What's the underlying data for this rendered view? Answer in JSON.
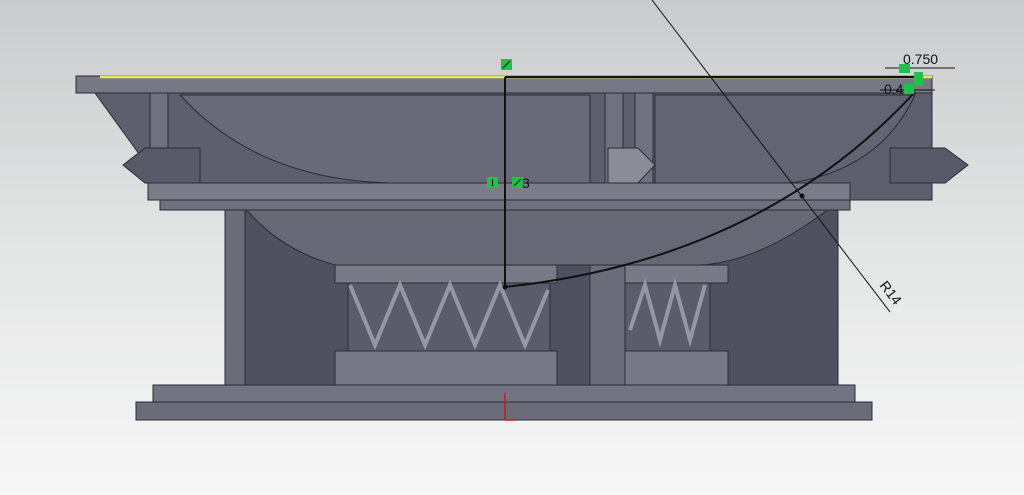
{
  "viewport": {
    "dimensions": [
      {
        "id": "width-dim",
        "label": "0.750"
      },
      {
        "id": "offset-dim",
        "label": "0.4"
      },
      {
        "id": "radius-dim",
        "label": "R14"
      }
    ],
    "relation_label": "3",
    "colors": {
      "body": "#5f6170",
      "body_dark": "#4e5060",
      "body_light": "#7a7c8a",
      "edge": "#2a2b33",
      "selection": "#e8e85a",
      "relation": "#22c04a",
      "origin": "#d01818"
    }
  }
}
